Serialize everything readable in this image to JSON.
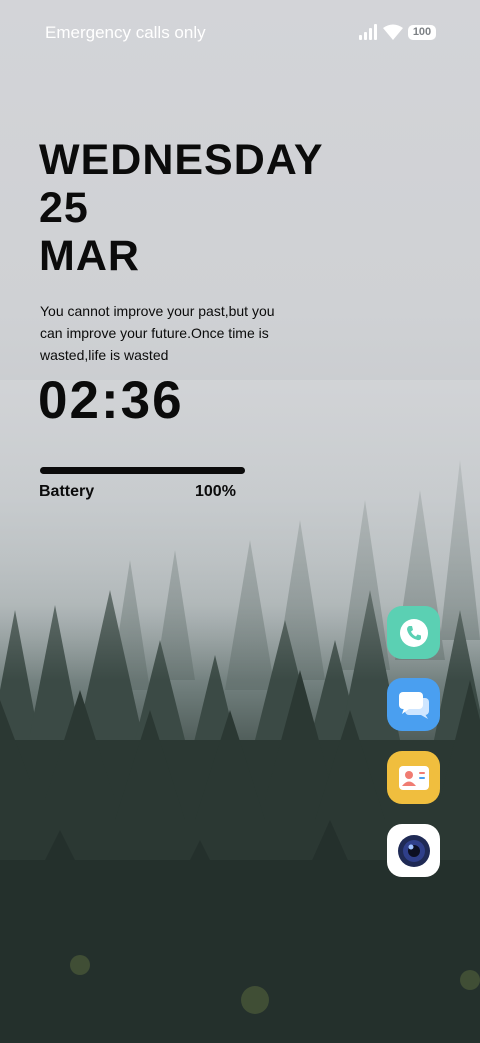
{
  "status_bar": {
    "carrier": "Emergency calls only",
    "battery_level": "100",
    "icons": [
      "signal-icon",
      "wifi-icon",
      "battery-icon"
    ]
  },
  "lockscreen": {
    "day": "WEDNESDAY",
    "date": "25",
    "month": "MAR",
    "quote": "You cannot improve your past,but you can improve your future.Once time is wasted,life is wasted",
    "time": "02:36"
  },
  "battery_widget": {
    "label": "Battery",
    "value": "100%",
    "fill_fraction": 1.0
  },
  "dock": {
    "apps": [
      "phone-icon",
      "messages-icon",
      "contacts-icon",
      "camera-icon"
    ],
    "colors": {
      "phone": "#5bd0b3",
      "messages": "#4a9ff0",
      "contacts": "#f0be3e",
      "camera": "#ffffff"
    }
  }
}
